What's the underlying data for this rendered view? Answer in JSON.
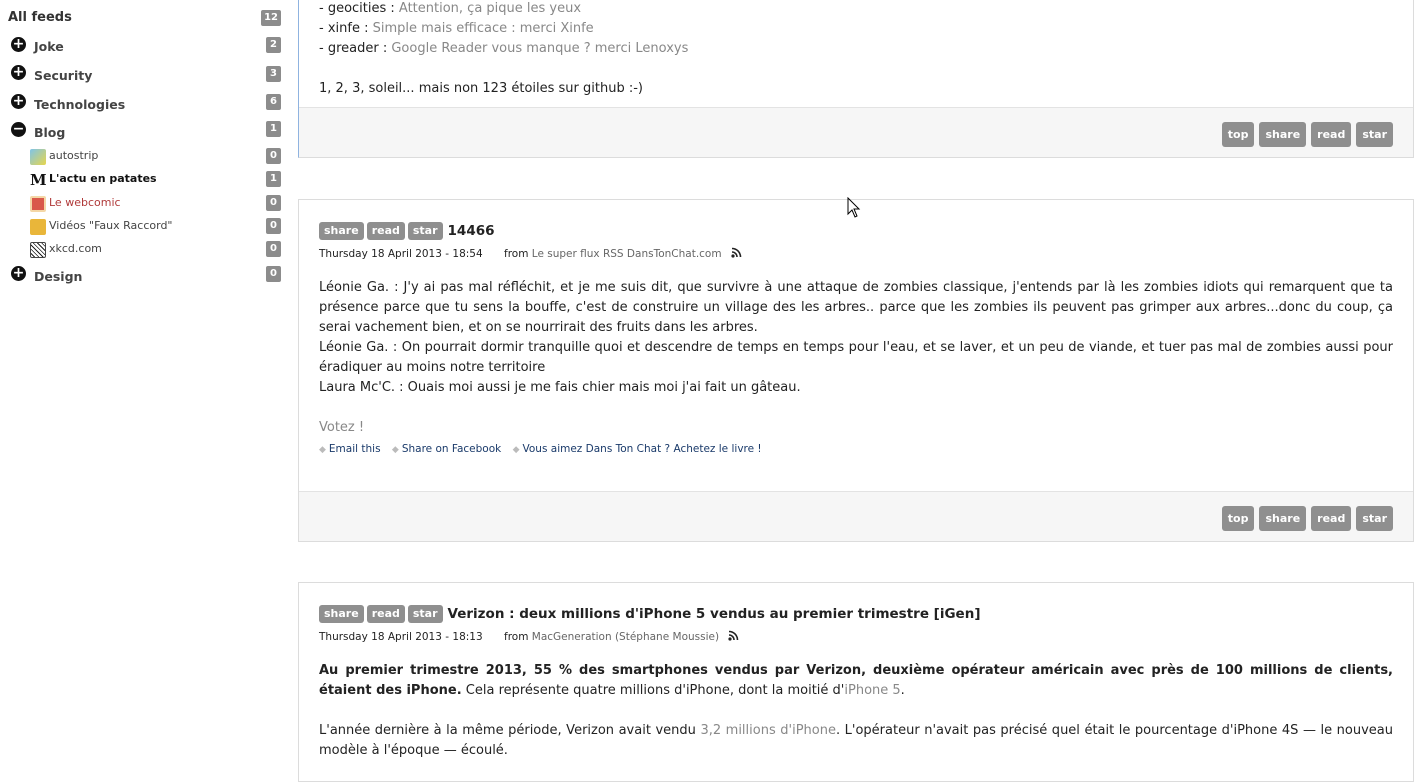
{
  "sidebar": {
    "all_feeds": {
      "label": "All feeds",
      "count": "12"
    },
    "categories": [
      {
        "label": "Joke",
        "count": "2",
        "toggle": "+"
      },
      {
        "label": "Security",
        "count": "3",
        "toggle": "+"
      },
      {
        "label": "Technologies",
        "count": "6",
        "toggle": "+"
      },
      {
        "label": "Blog",
        "count": "1",
        "toggle": "−"
      }
    ],
    "blog_feeds": [
      {
        "label": "autostrip",
        "count": "0",
        "icon": "autostrip-icon"
      },
      {
        "label": "L'actu en patates",
        "count": "1",
        "icon": "patates-icon"
      },
      {
        "label": "Le webcomic",
        "count": "0",
        "icon": "webcomic-icon"
      },
      {
        "label": "Vidéos \"Faux Raccord\"",
        "count": "0",
        "icon": "faux-raccord-icon"
      },
      {
        "label": "xkcd.com",
        "count": "0",
        "icon": "xkcd-icon"
      }
    ],
    "design": {
      "label": "Design",
      "count": "0",
      "toggle": "+"
    }
  },
  "article1": {
    "lines": [
      {
        "prefix": "- geocities : ",
        "link": "Attention, ça pique les yeux"
      },
      {
        "prefix": "- xinfe : ",
        "link": "Simple mais efficace : merci Xinfe"
      },
      {
        "prefix": "- greader : ",
        "link": "Google Reader vous manque ? merci Lenoxys"
      }
    ],
    "closing": "1, 2, 3, soleil... mais non 123 étoiles sur github :-)"
  },
  "buttons": {
    "top": "top",
    "share": "share",
    "read": "read",
    "star": "star"
  },
  "article2": {
    "title": "14466",
    "date": "Thursday 18 April 2013 - 18:54",
    "from_label": "from",
    "source": "Le super flux RSS DansTonChat.com",
    "paragraphs": [
      "Léonie Ga. : J'y ai pas mal réfléchit, et je me suis dit, que survivre à une attaque de zombies classique, j'entends par là les zombies idiots qui remarquent que ta présence parce que tu sens la bouffe, c'est de construire un village des les arbres.. parce que les zombies ils peuvent pas grimper aux arbres...donc du coup, ça serai vachement bien, et on se nourrirait des fruits dans les arbres.",
      "Léonie Ga. : On pourrait dormir tranquille quoi et descendre de temps en temps pour l'eau, et se laver, et un peu de viande, et tuer pas mal de zombies aussi pour éradiquer au moins notre territoire",
      "Laura Mc'C. : Ouais moi aussi je me fais chier mais moi j'ai fait un gâteau."
    ],
    "vote": "Votez !",
    "share_links": [
      "Email this",
      "Share on Facebook",
      "Vous aimez Dans Ton Chat ? Achetez le livre !"
    ]
  },
  "article3": {
    "title": "Verizon : deux millions d'iPhone 5 vendus au premier trimestre [iGen]",
    "date": "Thursday 18 April 2013 - 18:13",
    "from_label": "from",
    "source": "MacGeneration (Stéphane Moussie)",
    "lead_bold": "Au premier trimestre 2013, 55 % des smartphones vendus par Verizon, deuxième opérateur américain avec près de 100 millions de clients, étaient des iPhone.",
    "lead_rest": "Cela représente quatre millions d'iPhone, dont la moitié d'",
    "lead_link": "iPhone 5",
    "lead_end": ".",
    "p2_start": "L'année dernière à la même période, Verizon avait vendu ",
    "p2_link": "3,2 millions d'iPhone",
    "p2_end": ". L'opérateur n'avait pas précisé quel était le pourcentage d'iPhone 4S — le nouveau modèle à l'époque — écoulé."
  }
}
